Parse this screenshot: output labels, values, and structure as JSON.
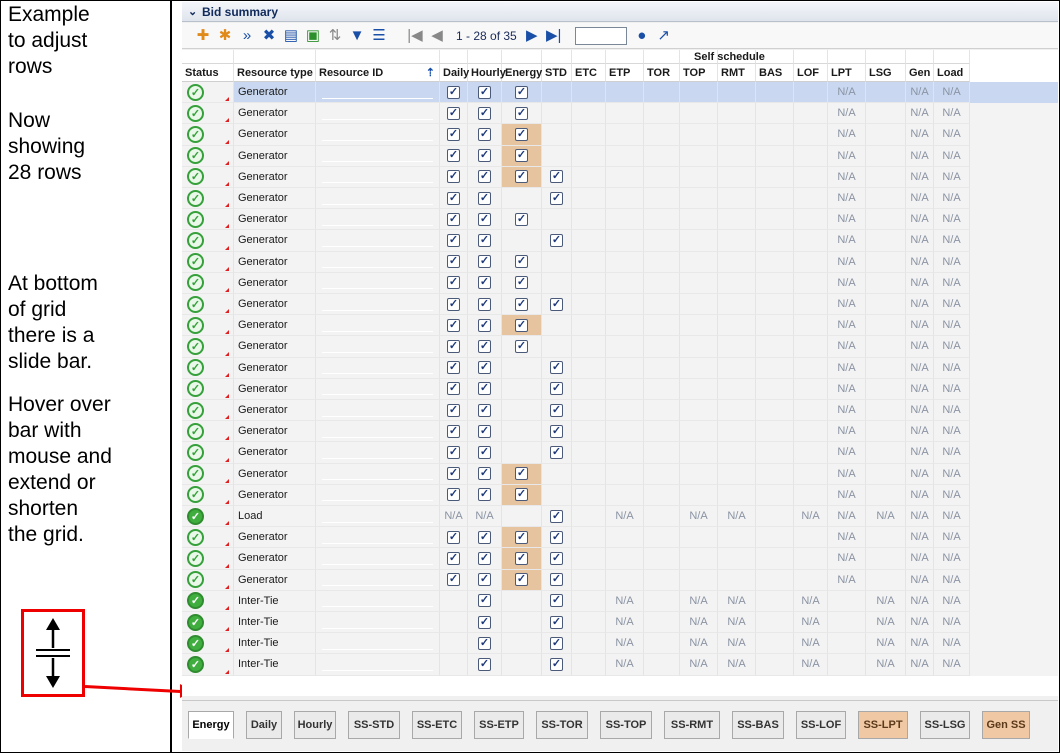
{
  "notes": [
    "Example\nto adjust\nrows",
    "Now\nshowing\n28 rows",
    "At bottom\nof grid\nthere is a\nslide bar.",
    "Hover over\nbar with\nmouse and\nextend or\nshorten\nthe grid."
  ],
  "panel": {
    "chevron": "⌄",
    "title": "Bid summary"
  },
  "pager": {
    "first": "|◀",
    "prev": "◀",
    "range": "1  -  28  of  35",
    "next": "▶",
    "last": "▶|"
  },
  "grid": {
    "super_header": "Self schedule",
    "columns": [
      "Status",
      "Resource type",
      "Resource ID",
      "Daily",
      "Hourly",
      "Energy",
      "STD",
      "ETC",
      "ETP",
      "TOR",
      "TOP",
      "RMT",
      "BAS",
      "LOF",
      "LPT",
      "LSG",
      "Gen",
      "Load"
    ],
    "sort_icon": "⇡",
    "na_text": "N/A",
    "check_mark": "✓",
    "rows": [
      {
        "type": "Generator",
        "d": "c",
        "h": "c",
        "e": "c",
        "s": "",
        "hl": false,
        "kind": "gen",
        "sel": true
      },
      {
        "type": "Generator",
        "d": "c",
        "h": "c",
        "e": "c",
        "s": "",
        "hl": false,
        "kind": "gen"
      },
      {
        "type": "Generator",
        "d": "c",
        "h": "c",
        "e": "c",
        "s": "",
        "hl": true,
        "kind": "gen"
      },
      {
        "type": "Generator",
        "d": "c",
        "h": "c",
        "e": "c",
        "s": "",
        "hl": true,
        "kind": "gen"
      },
      {
        "type": "Generator",
        "d": "c",
        "h": "c",
        "e": "c",
        "s": "c",
        "hl": true,
        "kind": "gen"
      },
      {
        "type": "Generator",
        "d": "c",
        "h": "c",
        "e": "",
        "s": "c",
        "hl": false,
        "kind": "gen"
      },
      {
        "type": "Generator",
        "d": "c",
        "h": "c",
        "e": "c",
        "s": "",
        "hl": false,
        "kind": "gen"
      },
      {
        "type": "Generator",
        "d": "c",
        "h": "c",
        "e": "",
        "s": "c",
        "hl": false,
        "kind": "gen"
      },
      {
        "type": "Generator",
        "d": "c",
        "h": "c",
        "e": "c",
        "s": "",
        "hl": false,
        "kind": "gen"
      },
      {
        "type": "Generator",
        "d": "c",
        "h": "c",
        "e": "c",
        "s": "",
        "hl": false,
        "kind": "gen"
      },
      {
        "type": "Generator",
        "d": "c",
        "h": "c",
        "e": "c",
        "s": "c",
        "hl": false,
        "kind": "gen"
      },
      {
        "type": "Generator",
        "d": "c",
        "h": "c",
        "e": "c",
        "s": "",
        "hl": true,
        "kind": "gen"
      },
      {
        "type": "Generator",
        "d": "c",
        "h": "c",
        "e": "c",
        "s": "",
        "hl": false,
        "kind": "gen"
      },
      {
        "type": "Generator",
        "d": "c",
        "h": "c",
        "e": "",
        "s": "c",
        "hl": false,
        "kind": "gen"
      },
      {
        "type": "Generator",
        "d": "c",
        "h": "c",
        "e": "",
        "s": "c",
        "hl": false,
        "kind": "gen"
      },
      {
        "type": "Generator",
        "d": "c",
        "h": "c",
        "e": "",
        "s": "c",
        "hl": false,
        "kind": "gen"
      },
      {
        "type": "Generator",
        "d": "c",
        "h": "c",
        "e": "",
        "s": "c",
        "hl": false,
        "kind": "gen"
      },
      {
        "type": "Generator",
        "d": "c",
        "h": "c",
        "e": "",
        "s": "c",
        "hl": false,
        "kind": "gen"
      },
      {
        "type": "Generator",
        "d": "c",
        "h": "c",
        "e": "c",
        "s": "",
        "hl": true,
        "kind": "gen"
      },
      {
        "type": "Generator",
        "d": "c",
        "h": "c",
        "e": "c",
        "s": "",
        "hl": true,
        "kind": "gen"
      },
      {
        "type": "Load",
        "d": "na",
        "h": "na",
        "e": "",
        "s": "c",
        "hl": false,
        "kind": "load"
      },
      {
        "type": "Generator",
        "d": "c",
        "h": "c",
        "e": "c",
        "s": "c",
        "hl": true,
        "kind": "gen"
      },
      {
        "type": "Generator",
        "d": "c",
        "h": "c",
        "e": "c",
        "s": "c",
        "hl": true,
        "kind": "gen"
      },
      {
        "type": "Generator",
        "d": "c",
        "h": "c",
        "e": "c",
        "s": "c",
        "hl": true,
        "kind": "gen"
      },
      {
        "type": "Inter-Tie",
        "d": "",
        "h": "c",
        "e": "",
        "s": "c",
        "hl": false,
        "kind": "tie"
      },
      {
        "type": "Inter-Tie",
        "d": "",
        "h": "c",
        "e": "",
        "s": "c",
        "hl": false,
        "kind": "tie"
      },
      {
        "type": "Inter-Tie",
        "d": "",
        "h": "c",
        "e": "",
        "s": "c",
        "hl": false,
        "kind": "tie"
      },
      {
        "type": "Inter-Tie",
        "d": "",
        "h": "c",
        "e": "",
        "s": "c",
        "hl": false,
        "kind": "tie"
      }
    ]
  },
  "tabs": [
    {
      "label": "Energy",
      "active": true
    },
    {
      "label": "Daily"
    },
    {
      "label": "Hourly"
    },
    {
      "label": "SS-STD"
    },
    {
      "label": "SS-ETC"
    },
    {
      "label": "SS-ETP"
    },
    {
      "label": "SS-TOR"
    },
    {
      "label": "SS-TOP"
    },
    {
      "label": "SS-RMT"
    },
    {
      "label": "SS-BAS"
    },
    {
      "label": "SS-LOF"
    },
    {
      "label": "SS-LPT",
      "orange": true
    },
    {
      "label": "SS-LSG"
    },
    {
      "label": "Gen SS",
      "orange": true
    }
  ],
  "colors": {
    "accent_red": "#e00000",
    "highlight": "#e6c4a0",
    "status_green": "#36a03a"
  },
  "icons": [
    "add-row-icon",
    "wand-icon",
    "run-icon",
    "delete-icon",
    "copy-icon",
    "export-icon",
    "sort-icon",
    "filter-icon",
    "columns-icon",
    "help-icon",
    "popout-icon",
    "resize-arrows-icon"
  ]
}
